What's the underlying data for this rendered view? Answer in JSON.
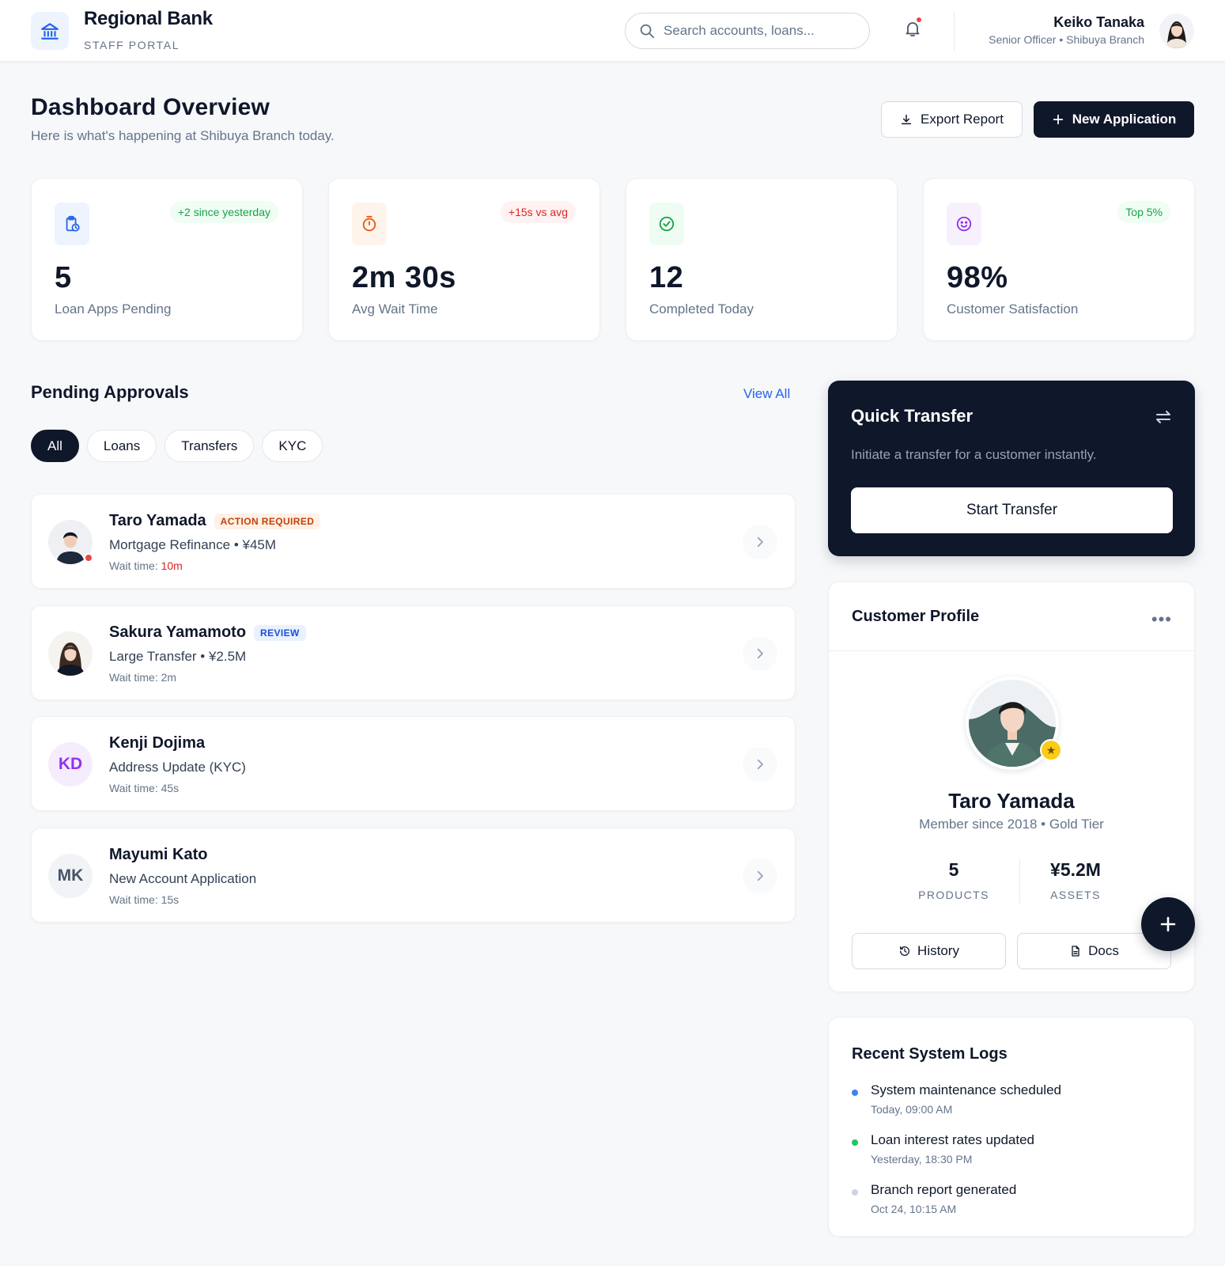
{
  "header": {
    "brand_name": "Regional Bank",
    "brand_sub": "STAFF PORTAL",
    "search_placeholder": "Search accounts, loans...",
    "user_name": "Keiko Tanaka",
    "user_role": "Senior Officer • Shibuya Branch"
  },
  "page": {
    "title": "Dashboard Overview",
    "subtitle": "Here is what's happening at Shibuya Branch today.",
    "export_label": "Export Report",
    "new_label": "New Application"
  },
  "stats": [
    {
      "value": "5",
      "label": "Loan Apps Pending",
      "badge": "+2 since yesterday",
      "icon": "clipboard-clock-icon",
      "color": "#2563eb"
    },
    {
      "value": "2m 30s",
      "label": "Avg Wait Time",
      "badge": "+15s vs avg",
      "icon": "stopwatch-icon",
      "color": "#ea580c"
    },
    {
      "value": "12",
      "label": "Completed Today",
      "badge": "",
      "icon": "check-circle-icon",
      "color": "#16a34a"
    },
    {
      "value": "98%",
      "label": "Customer Satisfaction",
      "badge": "Top 5%",
      "icon": "smiley-icon",
      "color": "#9333ea"
    }
  ],
  "approvals": {
    "title": "Pending Approvals",
    "view_all": "View All",
    "filters": [
      "All",
      "Loans",
      "Transfers",
      "KYC"
    ],
    "active_filter": "All",
    "wait_prefix": "Wait time: ",
    "items": [
      {
        "name": "Taro Yamada",
        "tag": "ACTION REQUIRED",
        "desc": "Mortgage Refinance • ¥45M",
        "wait": "10m",
        "initials": ""
      },
      {
        "name": "Sakura Yamamoto",
        "tag": "REVIEW",
        "desc": "Large Transfer • ¥2.5M",
        "wait": "2m",
        "initials": ""
      },
      {
        "name": "Kenji Dojima",
        "tag": "",
        "desc": "Address Update (KYC)",
        "wait": "45s",
        "initials": "KD"
      },
      {
        "name": "Mayumi Kato",
        "tag": "",
        "desc": "New Account Application",
        "wait": "15s",
        "initials": "MK"
      }
    ]
  },
  "quick_transfer": {
    "title": "Quick Transfer",
    "subtitle": "Initiate a transfer for a customer instantly.",
    "button": "Start Transfer"
  },
  "profile": {
    "title": "Customer Profile",
    "name": "Taro Yamada",
    "meta": "Member since 2018 • Gold Tier",
    "products_value": "5",
    "products_label": "PRODUCTS",
    "assets_value": "¥5.2M",
    "assets_label": "ASSETS",
    "history_label": "History",
    "docs_label": "Docs"
  },
  "logs": {
    "title": "Recent System Logs",
    "items": [
      {
        "text": "System maintenance scheduled",
        "date": "Today, 09:00 AM",
        "color": "#3b82f6"
      },
      {
        "text": "Loan interest rates updated",
        "date": "Yesterday, 18:30 PM",
        "color": "#22c55e"
      },
      {
        "text": "Branch report generated",
        "date": "Oct 24, 10:15 AM",
        "color": "#cbd5e1"
      }
    ]
  }
}
